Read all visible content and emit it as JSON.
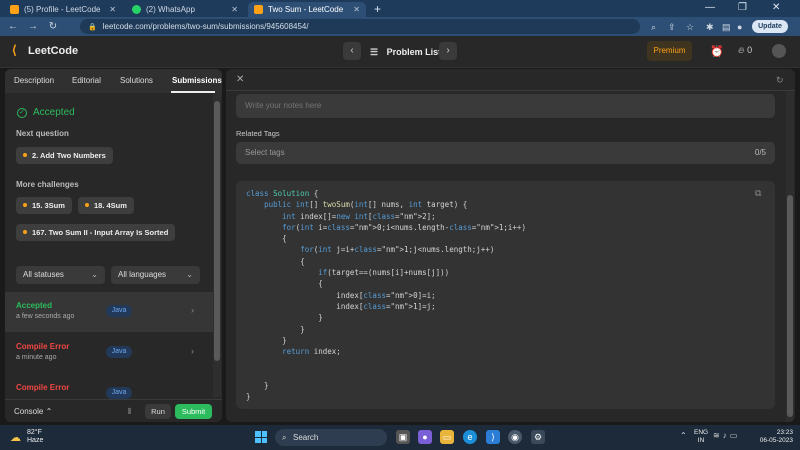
{
  "browser": {
    "tabs": [
      {
        "title": "(5) Profile - LeetCode",
        "icon_color": "#ffa116"
      },
      {
        "title": "(2) WhatsApp",
        "icon_color": "#25d366"
      },
      {
        "title": "Two Sum - LeetCode",
        "icon_color": "#ffa116"
      }
    ],
    "url": "leetcode.com/problems/two-sum/submissions/945608454/",
    "update_label": "Update"
  },
  "header": {
    "logo_text": "LeetCode",
    "problem_list_label": "Problem List",
    "premium_label": "Premium",
    "streak_count": "0"
  },
  "left": {
    "tabs": [
      "Description",
      "Editorial",
      "Solutions",
      "Submissions"
    ],
    "status": "Accepted",
    "next_question_title": "Next question",
    "next_question": "2. Add Two Numbers",
    "more_challenges_title": "More challenges",
    "challenges": [
      "15. 3Sum",
      "18. 4Sum",
      "167. Two Sum II - Input Array Is Sorted"
    ],
    "filters": {
      "status": "All statuses",
      "language": "All languages"
    },
    "submissions": [
      {
        "status": "Accepted",
        "time": "a few seconds ago",
        "lang": "Java",
        "color": "#2cbb5d"
      },
      {
        "status": "Compile Error",
        "time": "a minute ago",
        "lang": "Java",
        "color": "#ef4743"
      },
      {
        "status": "Compile Error",
        "time": "",
        "lang": "Java",
        "color": "#ef4743"
      }
    ],
    "console_label": "Console",
    "run_label": "Run",
    "submit_label": "Submit"
  },
  "right": {
    "notes_placeholder": "Write your notes here",
    "related_tags_label": "Related Tags",
    "tags_placeholder": "Select tags",
    "tags_count": "0/5"
  },
  "code_lines": [
    "class Solution {",
    "    public int[] twoSum(int[] nums, int target) {",
    "        int index[]=new int[2];",
    "        for(int i=0;i<nums.length-1;i++)",
    "        {",
    "            for(int j=i+1;j<nums.length;j++)",
    "            {",
    "                if(target==(nums[i]+nums[j]))",
    "                {",
    "                    index[0]=i;",
    "                    index[1]=j;",
    "                }",
    "            }",
    "        }",
    "        return index;",
    "",
    "",
    "    }",
    "}"
  ],
  "taskbar": {
    "temperature": "82°F",
    "weather": "Haze",
    "search_label": "Search",
    "lang_line1": "ENG",
    "lang_line2": "IN",
    "time": "23:23",
    "date": "06-05-2023"
  }
}
